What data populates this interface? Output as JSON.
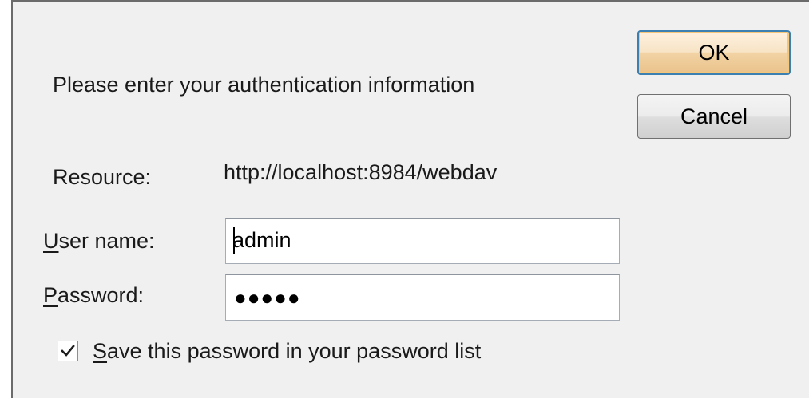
{
  "dialog": {
    "prompt": "Please enter your authentication information",
    "resource_label": "Resource:",
    "resource_value": "http://localhost:8984/webdav",
    "username_label_accel": "U",
    "username_label_rest": "ser name:",
    "username_value": "admin",
    "password_label_accel": "P",
    "password_label_rest": "assword:",
    "password_mask": "●●●●●",
    "save_password_accel": "S",
    "save_password_rest": "ave this password in your password list",
    "save_password_checked": true
  },
  "buttons": {
    "ok_label": "OK",
    "cancel_label": "Cancel"
  },
  "icons": {
    "checkbox_check": "check-icon"
  },
  "colors": {
    "dialog_background": "#f0f0f0",
    "default_button_border": "#3c7fb1"
  }
}
